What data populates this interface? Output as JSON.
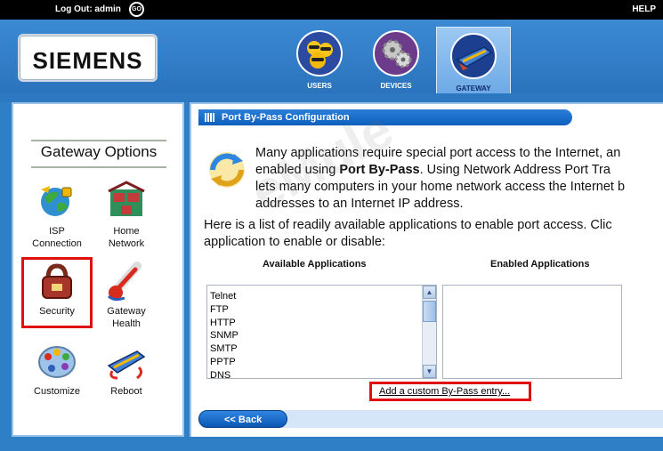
{
  "topbar": {
    "logout_text": "Log Out: admin",
    "go_label": "GO",
    "help_label": "HELP"
  },
  "header": {
    "brand": "SIEMENS",
    "tabs": [
      {
        "label": "USERS",
        "icon": "users-icon"
      },
      {
        "label": "DEVICES",
        "icon": "devices-icon"
      },
      {
        "label": "GATEWAY",
        "icon": "gateway-icon",
        "active": true
      }
    ]
  },
  "sidebar": {
    "title": "Gateway Options",
    "options": [
      {
        "label": "ISP\nConnection",
        "l1": "ISP",
        "l2": "Connection",
        "icon": "isp-connection-icon"
      },
      {
        "l1": "Home",
        "l2": "Network",
        "icon": "home-network-icon"
      },
      {
        "l1": "Security",
        "l2": "",
        "icon": "security-lock-icon"
      },
      {
        "l1": "Gateway",
        "l2": "Health",
        "icon": "thermometer-icon"
      },
      {
        "l1": "Customize",
        "l2": "",
        "icon": "palette-icon"
      },
      {
        "l1": "Reboot",
        "l2": "",
        "icon": "reboot-icon"
      }
    ]
  },
  "main": {
    "section_title": "Port By-Pass Configuration",
    "intro": {
      "line1": "Many applications require special port access to the Internet, an",
      "line2_pre": "enabled using ",
      "line2_bold": "Port By-Pass",
      "line2_post": ". Using Network Address Port Tra",
      "line3": "lets many computers in your home network access the Internet b",
      "line4": "addresses to an Internet IP address."
    },
    "list_intro": {
      "line1": "Here is a list of readily available applications to enable port access. Clic",
      "line2": "application to enable or disable:"
    },
    "available_header": "Available Applications",
    "enabled_header": "Enabled Applications",
    "available_apps": [
      "Telnet",
      "FTP",
      "HTTP",
      "SNMP",
      "SMTP",
      "PPTP",
      "DNS"
    ],
    "custom_link": "Add a custom By-Pass entry...",
    "back_button": "<< Back"
  },
  "watermark": "eMule"
}
